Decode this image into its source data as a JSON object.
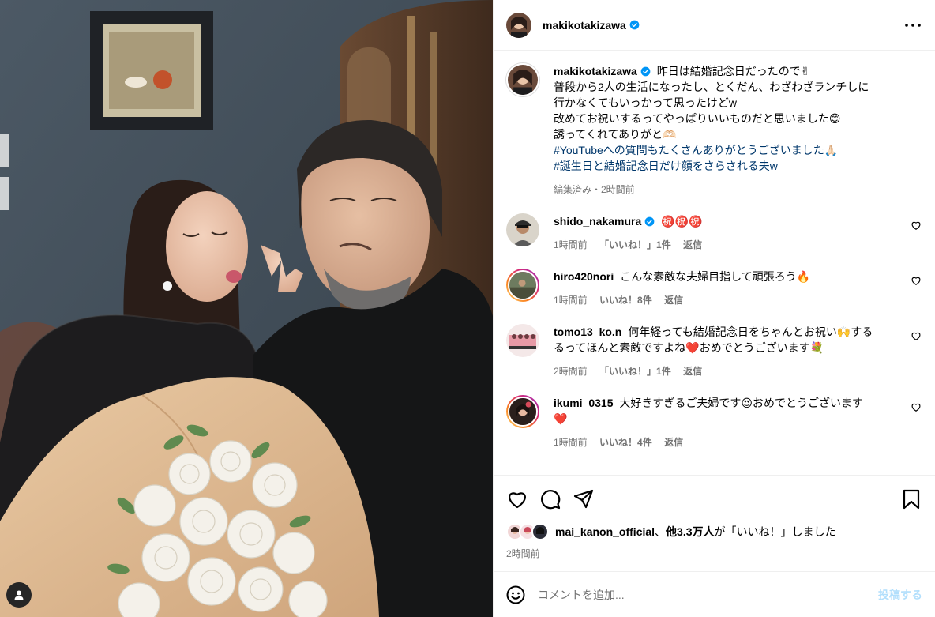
{
  "post": {
    "author": "makikotakizawa",
    "verified": true,
    "image_alt": "Couple holding a bouquet of white roses",
    "caption_lines": [
      "昨日は結婚記念日だったので✌",
      "普段から2人の生活になったし、とくだん、わざわざランチしに",
      "行かなくてもいっかって思ったけどw",
      "改めてお祝いするってやっぱりいいものだと思いました😊",
      "誘ってくれてありがと🫶🏻"
    ],
    "hashtags": [
      "#YouTubeへの質問もたくさんありがとうございました🙏🏻",
      "#誕生日と結婚記念日だけ顔をさらされる夫w"
    ],
    "caption_meta": "編集済み・2時間前"
  },
  "comments": [
    {
      "user": "shido_nakamura",
      "verified": true,
      "text": "㊗️㊗️㊗️",
      "time": "1時間前",
      "likes": "「いいね！」1件",
      "reply": "返信"
    },
    {
      "user": "hiro420nori",
      "verified": false,
      "text": "こんな素敵な夫婦目指して頑張ろう🔥",
      "time": "1時間前",
      "likes": "いいね！8件",
      "reply": "返信"
    },
    {
      "user": "tomo13_ko.n",
      "verified": false,
      "text": "何年経っても結婚記念日をちゃんとお祝い🙌する\nるってほんと素敵ですよね❤️おめでとうございます💐",
      "time": "2時間前",
      "likes": "「いいね！」1件",
      "reply": "返信"
    },
    {
      "user": "ikumi_0315",
      "verified": false,
      "text": "大好きすぎるご夫婦です😍おめでとうございます\n❤️",
      "time": "1時間前",
      "likes": "いいね！4件",
      "reply": "返信"
    }
  ],
  "likes_line": {
    "first_user": "mai_kanon_official",
    "sep": "、",
    "others": "他3.3万人",
    "suffix": "が「いいね！」しました"
  },
  "posted_time": "2時間前",
  "add_comment": {
    "placeholder": "コメントを追加...",
    "post_label": "投稿する"
  },
  "icons": {
    "more": "more-dots-icon",
    "like": "heart-icon",
    "comment": "comment-bubble-icon",
    "share": "paper-plane-icon",
    "save": "bookmark-icon",
    "emoji": "emoji-smile-icon",
    "tag": "user-tag-icon"
  },
  "colors": {
    "verified": "#0095f6",
    "hashtag": "#00376b",
    "secondary_text": "#737373",
    "post_button_disabled": "#b2dffc",
    "divider": "#efefef"
  }
}
